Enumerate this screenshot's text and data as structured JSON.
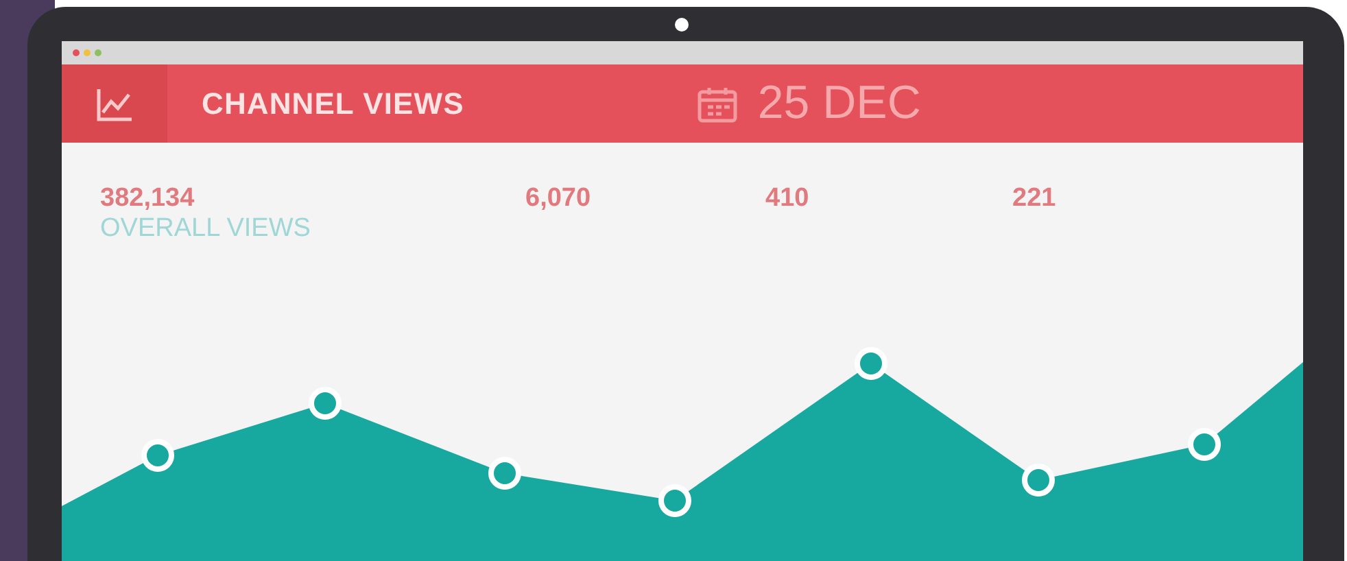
{
  "header": {
    "title": "CHANNEL VIEWS",
    "date": "25 DEC"
  },
  "stats": [
    {
      "value": "382,134",
      "label": "OVERALL VIEWS"
    },
    {
      "value": "6,070"
    },
    {
      "value": "410"
    },
    {
      "value": "221"
    }
  ]
}
